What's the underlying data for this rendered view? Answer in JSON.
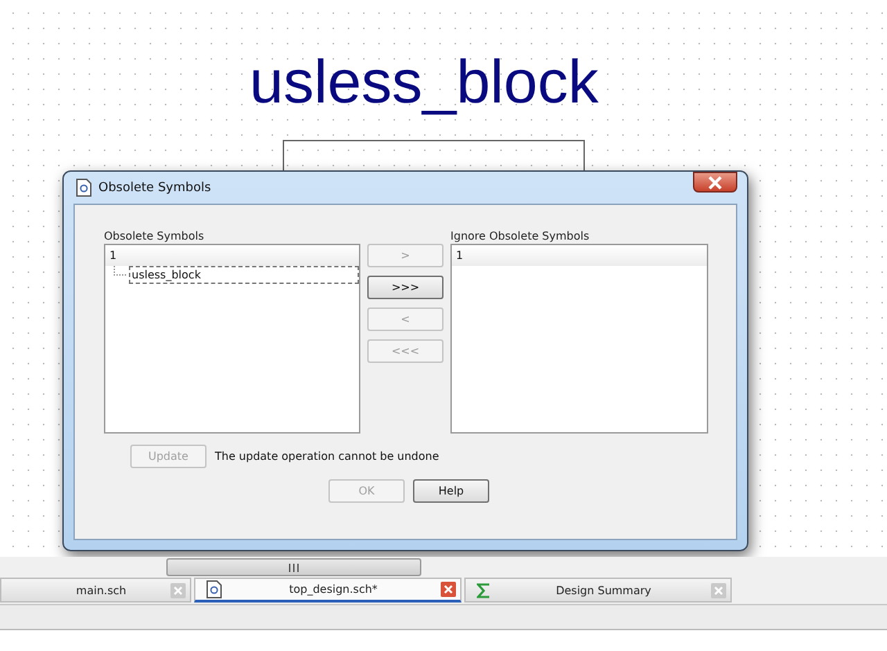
{
  "schematic": {
    "symbol_name": "usless_block"
  },
  "dialog": {
    "title": "Obsolete Symbols",
    "obsolete_list": {
      "label": "Obsolete Symbols",
      "groups": [
        {
          "label": "1",
          "children": [
            {
              "label": "usless_block",
              "focused": true
            }
          ]
        }
      ]
    },
    "move_buttons": [
      {
        "label": ">",
        "disabled": true
      },
      {
        "label": ">>>",
        "disabled": false
      },
      {
        "label": "<",
        "disabled": true
      },
      {
        "label": "<<<",
        "disabled": true
      }
    ],
    "ignore_list": {
      "label": "Ignore Obsolete Symbols",
      "groups": [
        {
          "label": "1"
        }
      ]
    },
    "update_button": {
      "label": "Update",
      "disabled": true
    },
    "update_note": "The update operation cannot be undone",
    "buttons": [
      {
        "label": "OK",
        "disabled": true
      },
      {
        "label": "Help",
        "disabled": false
      }
    ]
  },
  "tabs": [
    {
      "label": "main.sch",
      "kind": "plain",
      "selected": false
    },
    {
      "label": "top_design.sch*",
      "kind": "schematic",
      "selected": true
    },
    {
      "label": "Design Summary",
      "kind": "summary",
      "selected": false
    }
  ]
}
